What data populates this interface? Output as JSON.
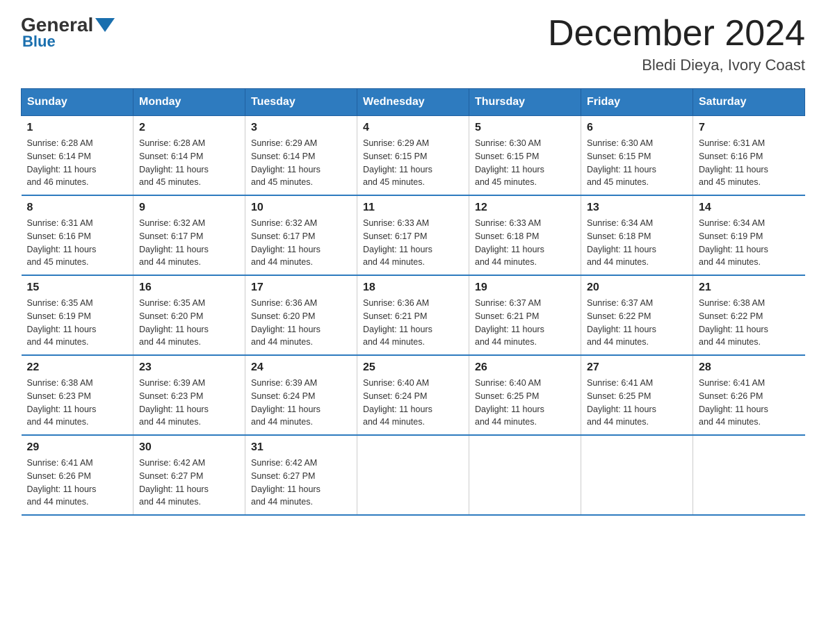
{
  "logo": {
    "general": "General",
    "blue": "Blue"
  },
  "title": "December 2024",
  "subtitle": "Bledi Dieya, Ivory Coast",
  "days_of_week": [
    "Sunday",
    "Monday",
    "Tuesday",
    "Wednesday",
    "Thursday",
    "Friday",
    "Saturday"
  ],
  "weeks": [
    [
      {
        "day": "1",
        "sunrise": "6:28 AM",
        "sunset": "6:14 PM",
        "daylight": "11 hours and 46 minutes."
      },
      {
        "day": "2",
        "sunrise": "6:28 AM",
        "sunset": "6:14 PM",
        "daylight": "11 hours and 45 minutes."
      },
      {
        "day": "3",
        "sunrise": "6:29 AM",
        "sunset": "6:14 PM",
        "daylight": "11 hours and 45 minutes."
      },
      {
        "day": "4",
        "sunrise": "6:29 AM",
        "sunset": "6:15 PM",
        "daylight": "11 hours and 45 minutes."
      },
      {
        "day": "5",
        "sunrise": "6:30 AM",
        "sunset": "6:15 PM",
        "daylight": "11 hours and 45 minutes."
      },
      {
        "day": "6",
        "sunrise": "6:30 AM",
        "sunset": "6:15 PM",
        "daylight": "11 hours and 45 minutes."
      },
      {
        "day": "7",
        "sunrise": "6:31 AM",
        "sunset": "6:16 PM",
        "daylight": "11 hours and 45 minutes."
      }
    ],
    [
      {
        "day": "8",
        "sunrise": "6:31 AM",
        "sunset": "6:16 PM",
        "daylight": "11 hours and 45 minutes."
      },
      {
        "day": "9",
        "sunrise": "6:32 AM",
        "sunset": "6:17 PM",
        "daylight": "11 hours and 44 minutes."
      },
      {
        "day": "10",
        "sunrise": "6:32 AM",
        "sunset": "6:17 PM",
        "daylight": "11 hours and 44 minutes."
      },
      {
        "day": "11",
        "sunrise": "6:33 AM",
        "sunset": "6:17 PM",
        "daylight": "11 hours and 44 minutes."
      },
      {
        "day": "12",
        "sunrise": "6:33 AM",
        "sunset": "6:18 PM",
        "daylight": "11 hours and 44 minutes."
      },
      {
        "day": "13",
        "sunrise": "6:34 AM",
        "sunset": "6:18 PM",
        "daylight": "11 hours and 44 minutes."
      },
      {
        "day": "14",
        "sunrise": "6:34 AM",
        "sunset": "6:19 PM",
        "daylight": "11 hours and 44 minutes."
      }
    ],
    [
      {
        "day": "15",
        "sunrise": "6:35 AM",
        "sunset": "6:19 PM",
        "daylight": "11 hours and 44 minutes."
      },
      {
        "day": "16",
        "sunrise": "6:35 AM",
        "sunset": "6:20 PM",
        "daylight": "11 hours and 44 minutes."
      },
      {
        "day": "17",
        "sunrise": "6:36 AM",
        "sunset": "6:20 PM",
        "daylight": "11 hours and 44 minutes."
      },
      {
        "day": "18",
        "sunrise": "6:36 AM",
        "sunset": "6:21 PM",
        "daylight": "11 hours and 44 minutes."
      },
      {
        "day": "19",
        "sunrise": "6:37 AM",
        "sunset": "6:21 PM",
        "daylight": "11 hours and 44 minutes."
      },
      {
        "day": "20",
        "sunrise": "6:37 AM",
        "sunset": "6:22 PM",
        "daylight": "11 hours and 44 minutes."
      },
      {
        "day": "21",
        "sunrise": "6:38 AM",
        "sunset": "6:22 PM",
        "daylight": "11 hours and 44 minutes."
      }
    ],
    [
      {
        "day": "22",
        "sunrise": "6:38 AM",
        "sunset": "6:23 PM",
        "daylight": "11 hours and 44 minutes."
      },
      {
        "day": "23",
        "sunrise": "6:39 AM",
        "sunset": "6:23 PM",
        "daylight": "11 hours and 44 minutes."
      },
      {
        "day": "24",
        "sunrise": "6:39 AM",
        "sunset": "6:24 PM",
        "daylight": "11 hours and 44 minutes."
      },
      {
        "day": "25",
        "sunrise": "6:40 AM",
        "sunset": "6:24 PM",
        "daylight": "11 hours and 44 minutes."
      },
      {
        "day": "26",
        "sunrise": "6:40 AM",
        "sunset": "6:25 PM",
        "daylight": "11 hours and 44 minutes."
      },
      {
        "day": "27",
        "sunrise": "6:41 AM",
        "sunset": "6:25 PM",
        "daylight": "11 hours and 44 minutes."
      },
      {
        "day": "28",
        "sunrise": "6:41 AM",
        "sunset": "6:26 PM",
        "daylight": "11 hours and 44 minutes."
      }
    ],
    [
      {
        "day": "29",
        "sunrise": "6:41 AM",
        "sunset": "6:26 PM",
        "daylight": "11 hours and 44 minutes."
      },
      {
        "day": "30",
        "sunrise": "6:42 AM",
        "sunset": "6:27 PM",
        "daylight": "11 hours and 44 minutes."
      },
      {
        "day": "31",
        "sunrise": "6:42 AM",
        "sunset": "6:27 PM",
        "daylight": "11 hours and 44 minutes."
      },
      {
        "day": "",
        "sunrise": "",
        "sunset": "",
        "daylight": ""
      },
      {
        "day": "",
        "sunrise": "",
        "sunset": "",
        "daylight": ""
      },
      {
        "day": "",
        "sunrise": "",
        "sunset": "",
        "daylight": ""
      },
      {
        "day": "",
        "sunrise": "",
        "sunset": "",
        "daylight": ""
      }
    ]
  ],
  "labels": {
    "sunrise": "Sunrise:",
    "sunset": "Sunset:",
    "daylight": "Daylight:"
  }
}
